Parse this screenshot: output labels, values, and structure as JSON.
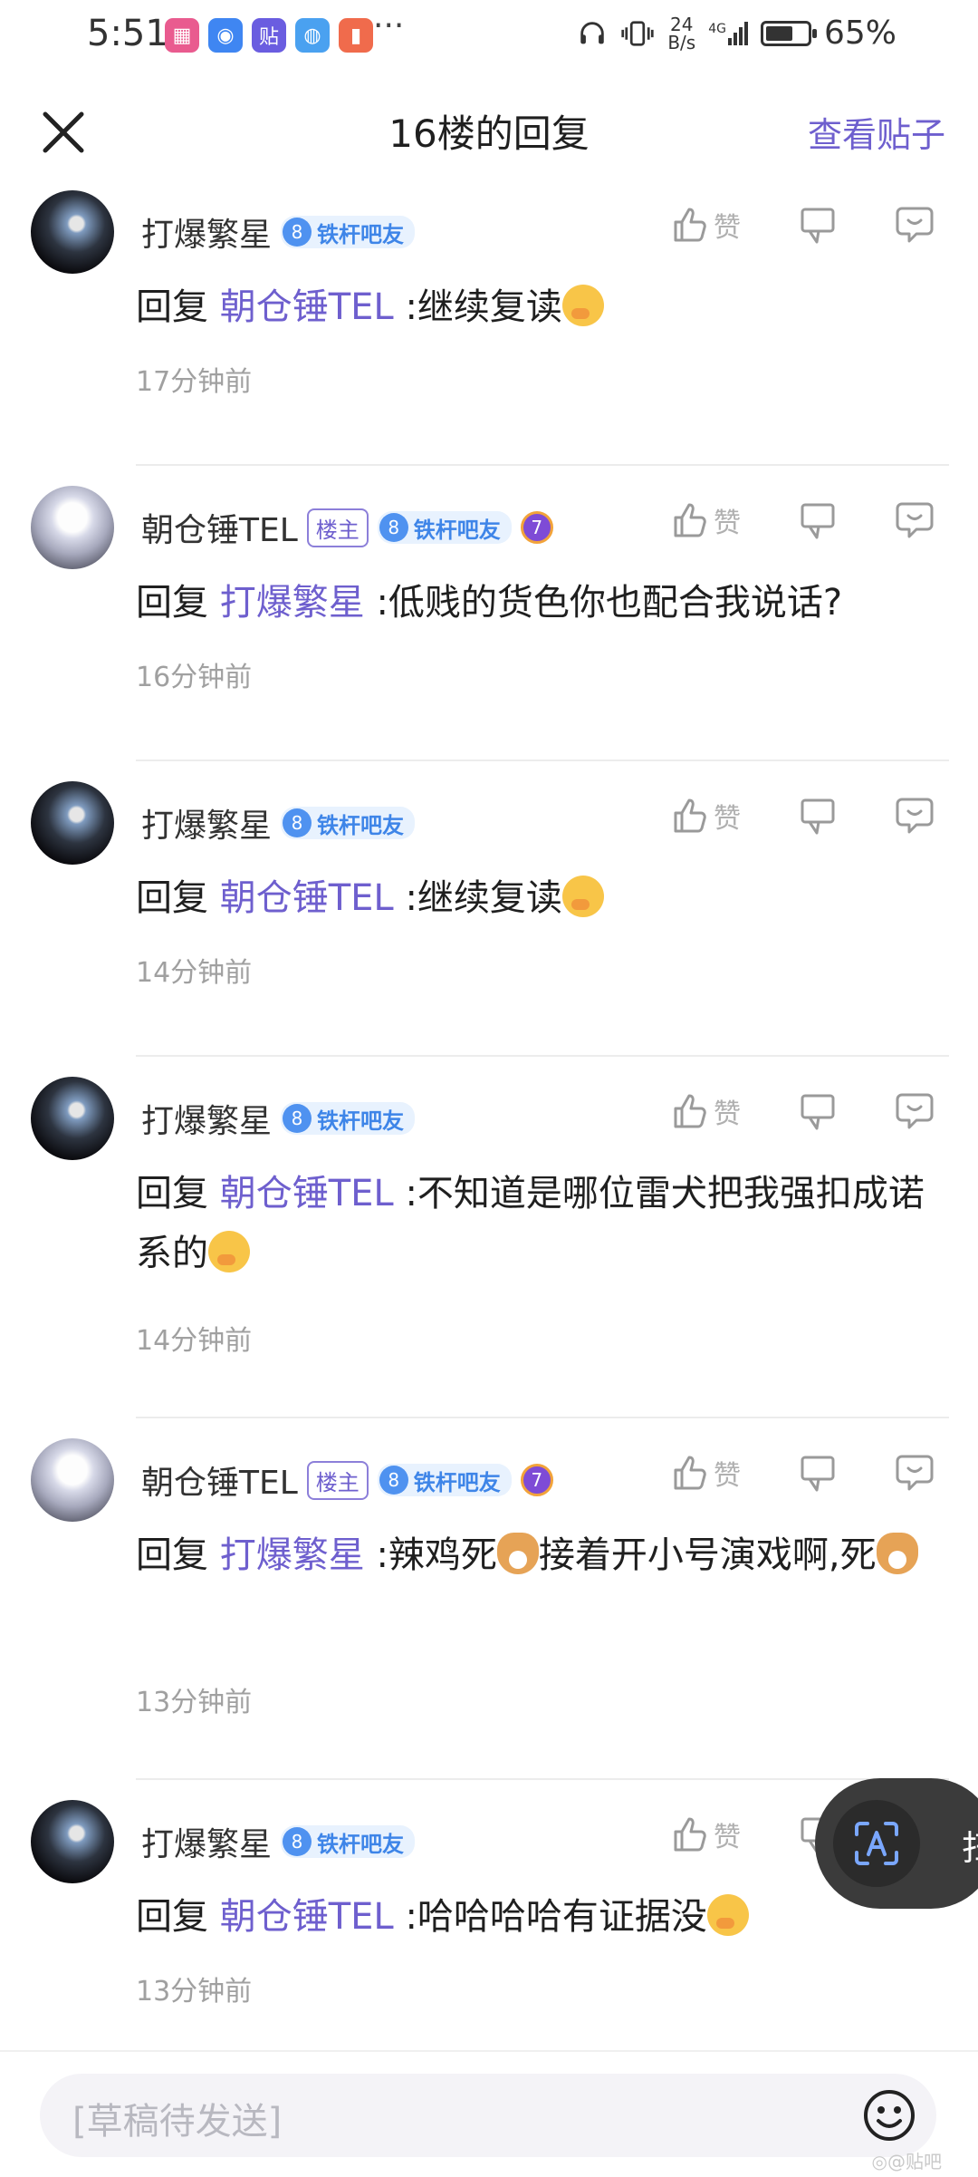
{
  "status_bar": {
    "time": "5:51",
    "apps": [
      {
        "icon": "app-multicolor-icon",
        "color": "#e95b8f",
        "glyph": "▦"
      },
      {
        "icon": "bulb-app-icon",
        "color": "#3f86f2",
        "glyph": "◉"
      },
      {
        "icon": "tieba-app-icon",
        "color": "#6a5de0",
        "glyph": "贴"
      },
      {
        "icon": "globe-app-icon",
        "color": "#4aa1f0",
        "glyph": "◍"
      },
      {
        "icon": "flag-app-icon",
        "color": "#f06b4c",
        "glyph": "▮"
      }
    ],
    "more": "···",
    "net_speed_value": "24",
    "net_speed_unit": "B/s",
    "network": "4G",
    "battery_level": 0.65,
    "battery_pct": "65%"
  },
  "header": {
    "title": "16楼的回复",
    "view_post": "查看贴子"
  },
  "reply_prefix": "回复",
  "like_label": "赞",
  "colors": {
    "accent": "#6e5fce",
    "level_badge": "#4f92f0"
  },
  "replies": [
    {
      "user": "打爆繁星",
      "is_owner": false,
      "level": "8",
      "level_name": "铁杆吧友",
      "has_medal": false,
      "target": "朝仓锤TEL",
      "text": ":继续复读",
      "emoji": "giggle",
      "text2": "",
      "emoji2": "",
      "time": "17分钟前"
    },
    {
      "user": "朝仓锤TEL",
      "is_owner": true,
      "owner_label": "楼主",
      "level": "8",
      "level_name": "铁杆吧友",
      "has_medal": true,
      "medal": "7",
      "target": "打爆繁星",
      "text": ":低贱的货色你也配合我说话?",
      "emoji": "",
      "text2": "",
      "emoji2": "",
      "time": "16分钟前"
    },
    {
      "user": "打爆繁星",
      "is_owner": false,
      "level": "8",
      "level_name": "铁杆吧友",
      "has_medal": false,
      "target": "朝仓锤TEL",
      "text": ":继续复读",
      "emoji": "giggle",
      "text2": "",
      "emoji2": "",
      "time": "14分钟前"
    },
    {
      "user": "打爆繁星",
      "is_owner": false,
      "level": "8",
      "level_name": "铁杆吧友",
      "has_medal": false,
      "target": "朝仓锤TEL",
      "text": ":不知道是哪位雷犬把我强扣成诺系的",
      "emoji": "giggle",
      "text2": "",
      "emoji2": "",
      "time": "14分钟前"
    },
    {
      "user": "朝仓锤TEL",
      "is_owner": true,
      "owner_label": "楼主",
      "level": "8",
      "level_name": "铁杆吧友",
      "has_medal": true,
      "medal": "7",
      "target": "打爆繁星",
      "text": ":辣鸡死",
      "emoji": "dog",
      "text2": "接着开小号演戏啊,死",
      "emoji2": "dog",
      "time": "13分钟前"
    },
    {
      "user": "打爆繁星",
      "is_owner": false,
      "level": "8",
      "level_name": "铁杆吧友",
      "has_medal": false,
      "target": "朝仓锤TEL",
      "text": ":哈哈哈哈有证据没",
      "emoji": "giggle",
      "text2": "",
      "emoji2": "",
      "time": "13分钟前"
    }
  ],
  "floating_button": {
    "partial_char": "扫"
  },
  "composer": {
    "placeholder": "[草稿待发送]"
  },
  "watermark": "◎@贴吧"
}
